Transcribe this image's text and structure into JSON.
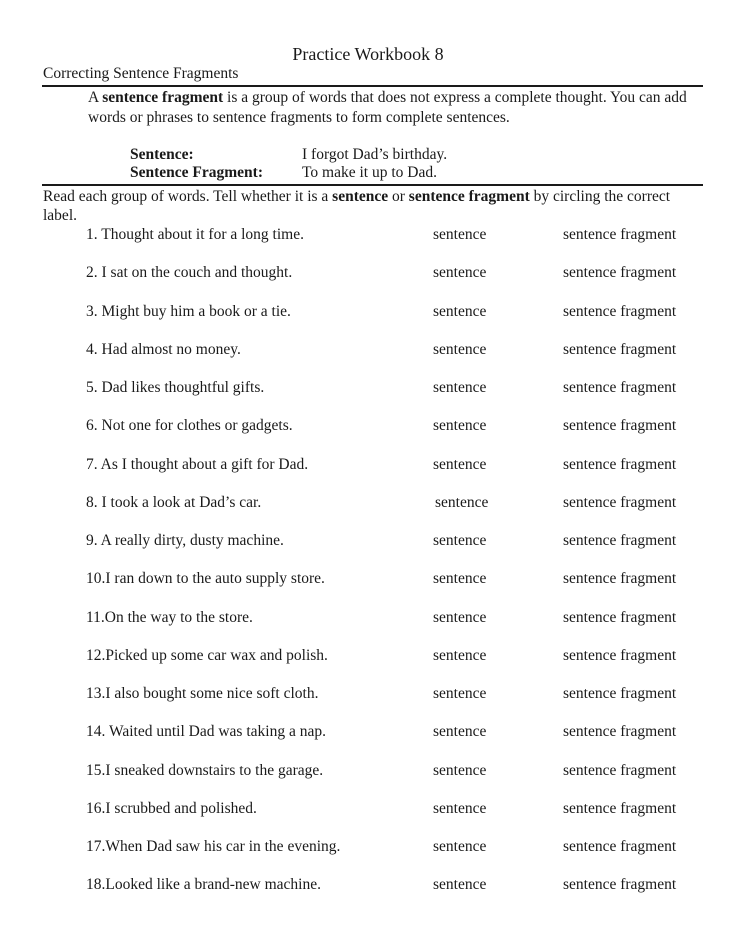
{
  "header": {
    "title": "Practice Workbook 8",
    "subtitle": "Correcting Sentence Fragments"
  },
  "intro": {
    "prefix": "A ",
    "term": "sentence fragment",
    "suffix": " is a group of words that does not express a complete thought.  You can add words or phrases to sentence fragments to form complete sentences."
  },
  "examples": [
    {
      "label": "Sentence:",
      "value": "I forgot Dad’s birthday."
    },
    {
      "label": "Sentence Fragment:",
      "value": "To make it up to Dad."
    }
  ],
  "instructions": {
    "part1": "Read each group of words.  Tell whether it is a ",
    "term1": "sentence",
    "part2": " or ",
    "term2": "sentence fragment",
    "part3": " by circling the correct label."
  },
  "options": {
    "sentence": "sentence",
    "fragment": "sentence fragment"
  },
  "items": [
    {
      "text": "1. Thought about it for a long time."
    },
    {
      "text": "2. I sat on the couch and thought."
    },
    {
      "text": "3. Might buy him a book or a tie."
    },
    {
      "text": "4. Had almost no money."
    },
    {
      "text": "5. Dad likes thoughtful gifts."
    },
    {
      "text": "6. Not one for clothes or gadgets."
    },
    {
      "text": "7. As I thought about a gift for Dad."
    },
    {
      "text": "8. I took a look at Dad’s car."
    },
    {
      "text": "9. A really dirty, dusty machine."
    },
    {
      "text": "10.I ran down to the auto supply store."
    },
    {
      "text": "11.On the way to the store."
    },
    {
      "text": "12.Picked up some car wax and polish."
    },
    {
      "text": "13.I also bought some nice soft cloth."
    },
    {
      "text": "14. Waited until Dad was taking a nap."
    },
    {
      "text": "15.I sneaked downstairs to the garage."
    },
    {
      "text": "16.I scrubbed and polished."
    },
    {
      "text": "17.When Dad saw his car in the evening."
    },
    {
      "text": "18.Looked like a brand-new machine."
    }
  ]
}
